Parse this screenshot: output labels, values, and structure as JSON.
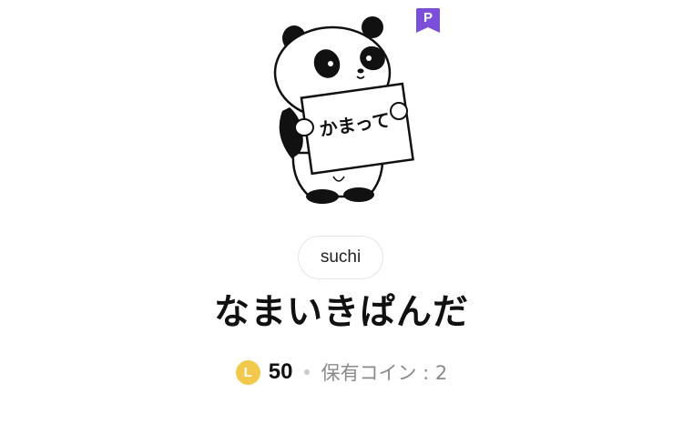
{
  "sticker": {
    "sign_text": "かまって"
  },
  "badge": {
    "letter": "P",
    "color": "#7b4fd9"
  },
  "author": {
    "name": "suchi"
  },
  "title": "なまいきぱんだ",
  "price": {
    "currency_icon": "L",
    "amount": "50",
    "owned_label": "保有コイン : 2",
    "coin_color": "#f2c94c"
  }
}
